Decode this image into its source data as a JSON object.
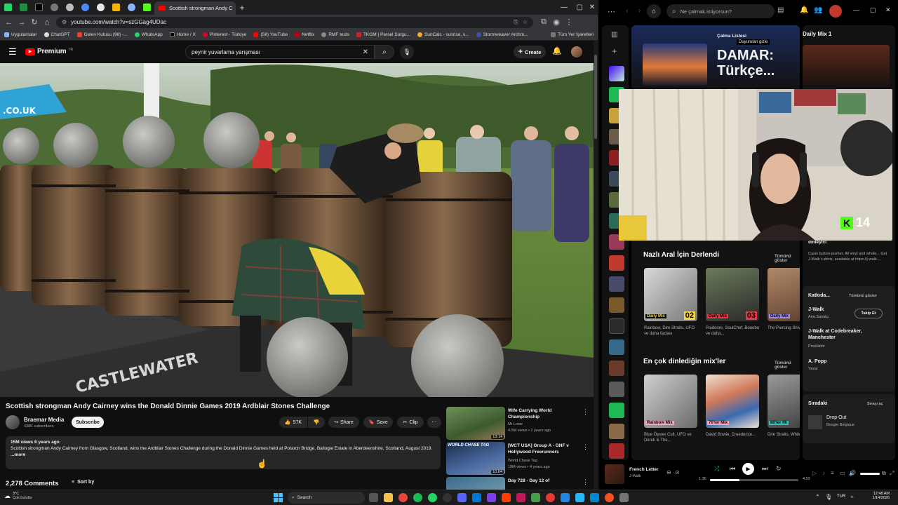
{
  "chrome": {
    "active_tab_title": "Scottish strongman Andy C",
    "url": "youtube.com/watch?v=szGGag4UDac",
    "bookmarks": [
      "Uygulamalar",
      "ChatGPT",
      "Gelen Kutusu (98) -...",
      "WhatsApp",
      "Home / X",
      "Pinterest - Türkiye",
      "(58) YouTube",
      "Netflix",
      "RMF tests",
      "TKGM | Parsel Sorgu...",
      "SunCalc - sunrise, s...",
      "Stormweaver Archm..."
    ],
    "all_bookmarks": "Tüm Yer İşaretleri"
  },
  "youtube": {
    "logo": "Premium",
    "logo_sup": "TR",
    "search_value": "peynir yuvarlama yarışması",
    "create_label": "Create",
    "video_title": "Scottish strongman Andy Cairney wins the Donald Dinnie Games 2019 Ardblair Stones Challenge",
    "channel": "Braemar Media",
    "subscribers": "438K subscribers",
    "subscribe_label": "Subscribe",
    "likes": "57K",
    "share_label": "Share",
    "save_label": "Save",
    "clip_label": "Clip",
    "desc_meta": "15M views  6 years ago",
    "desc_text": "Scottish strongman Andy Cairney from Glasgow, Scotland, wins the Ardblair Stones Challenge during the Donald Dinnie Games held at Potarch Bridge, Ballogie Estate in Aberdeenshire, Scotland, August 2019.",
    "desc_more": "...more",
    "comments": "2,278 Comments",
    "sort_by": "Sort by",
    "video_overlay_text": "CASTLEWATER",
    "video_banner_text": ".CO.UK",
    "recommendations": [
      {
        "title": "Wife Carrying World Championship",
        "channel": "Mr Lowe",
        "meta": "4.5M views • 2 years ago",
        "duration": "13:14"
      },
      {
        "title": "[WCT USA] Group A - GNF v Hollywood Freerunners",
        "channel": "World Chase Tag",
        "meta": "19M views • 4 years ago",
        "duration": "10:04",
        "thumb_text": "WORLD CHASE TAG"
      },
      {
        "title": "Day 728 - Day 12 of",
        "channel": "",
        "meta": "",
        "duration": ""
      }
    ]
  },
  "spotify": {
    "search_placeholder": "Ne çalmak istiyorsun?",
    "playlist_kind": "Çalma Listesi",
    "announce": "Duyurulan gizle",
    "banner_title": "DAMAR: Türkçe...",
    "section1_title": "Nazlı Aral İçin Derlendi",
    "section2_title": "En çok dinlediğin mix'ler",
    "show_all": "Tümünü göster",
    "section1_cards": [
      {
        "tag": "Daily Mix",
        "num": "02",
        "desc": "Rainbow, Dire Straits, UFO ve daha fazlası"
      },
      {
        "tag": "Daily Mix",
        "num": "03",
        "desc": "Poidoore, SoulChef, Bonobo ve daha..."
      },
      {
        "tag": "Daily Mix",
        "num": "",
        "desc": "The Piercing Shivaree"
      }
    ],
    "section2_cards": [
      {
        "tag": "Rainbow Mix",
        "desc": "Blue Öyster Cult, UFO ve Derek & The..."
      },
      {
        "tag": "70'ler Mix",
        "desc": "David Bowie, Creedence..."
      },
      {
        "tag": "80'ler Mi",
        "desc": "Dire Straits, Whitesnake"
      }
    ],
    "right_panel": {
      "title": "Daily Mix 1",
      "listener": "dinleyici",
      "bio": "Casio button-pusher. All vinyl and whole... Get J-Walk t-shirts, available at https://j-walk-...",
      "credits_title": "Katkıda...",
      "credits_show_all": "Tümünü göster",
      "credit1_name": "J-Walk",
      "credit1_role": "Ana Sanatçı",
      "follow_label": "Takip Et",
      "credit2_name": "J-Walk at Codebreaker, Manchester",
      "credit2_role": "Prodüktör",
      "credit3_name": "A. Popp",
      "credit3_role": "Yazar",
      "queue_title": "Sıradaki",
      "queue_open": "Sırayı aç",
      "queue_track": "Drop Out",
      "queue_artist": "Boogie Belgique"
    },
    "player": {
      "track": "French Letter",
      "artist": "J-Walk",
      "elapsed": "1:36",
      "duration": "4:53",
      "progress": 0.33
    },
    "overlay_score": "14"
  },
  "taskbar": {
    "weather_temp": "3°C",
    "weather_desc": "Çok bulutlu",
    "search_label": "Search",
    "lang": "TUR",
    "time": "12:48 AM",
    "date": "1/14/2026"
  }
}
